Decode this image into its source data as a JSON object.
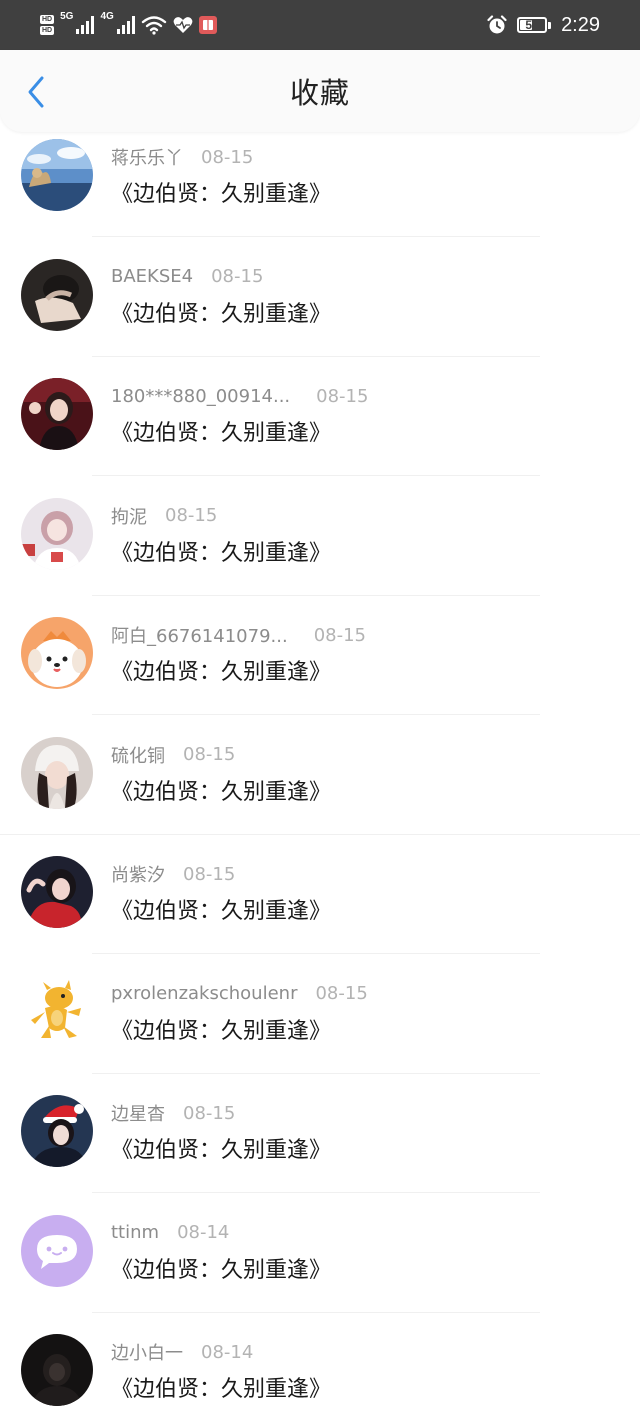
{
  "status_bar": {
    "hd1": "HD",
    "hd2": "HD",
    "net1": "5G",
    "net2": "4G",
    "battery": "54",
    "battery_level": 0.54,
    "time": "2:29",
    "icons": [
      "signal-icon",
      "wifi-icon",
      "heart-icon",
      "book-app-icon",
      "alarm-icon"
    ]
  },
  "header": {
    "title": "收藏",
    "back_icon": "chevron-left-icon",
    "accent": "#3a8ee6"
  },
  "favorites": [
    {
      "user": "蒋乐乐丫",
      "date": "08-15",
      "title": "《边伯贤：久别重逢》",
      "avatar": "photo-sky-dog"
    },
    {
      "user": "BAEKSE4",
      "date": "08-15",
      "title": "《边伯贤：久别重逢》",
      "avatar": "photo-dark-person"
    },
    {
      "user": "180***880_00914...",
      "date": "08-15",
      "title": "《边伯贤：久别重逢》",
      "avatar": "photo-girl-red"
    },
    {
      "user": "拘泥",
      "date": "08-15",
      "title": "《边伯贤：久别重逢》",
      "avatar": "photo-girl-light"
    },
    {
      "user": "阿白_6676141079...",
      "date": "08-15",
      "title": "《边伯贤：久别重逢》",
      "avatar": "cartoon-dog"
    },
    {
      "user": "硫化铜",
      "date": "08-15",
      "title": "《边伯贤：久别重逢》",
      "avatar": "photo-girl-white-hat"
    },
    {
      "user": "尚紫汐",
      "date": "08-15",
      "title": "《边伯贤：久别重逢》",
      "avatar": "photo-girl-red-shirt"
    },
    {
      "user": "pxrolenzakschoulenr",
      "date": "08-15",
      "title": "《边伯贤：久别重逢》",
      "avatar": "cartoon-yellow-dragon"
    },
    {
      "user": "边星杳",
      "date": "08-15",
      "title": "《边伯贤：久别重逢》",
      "avatar": "photo-girl-santa-hat"
    },
    {
      "user": "ttinm",
      "date": "08-14",
      "title": "《边伯贤：久别重逢》",
      "avatar": "default-chat-bubble"
    },
    {
      "user": "边小白一",
      "date": "08-14",
      "title": "《边伯贤：久别重逢》",
      "avatar": "photo-dark-portrait"
    }
  ]
}
